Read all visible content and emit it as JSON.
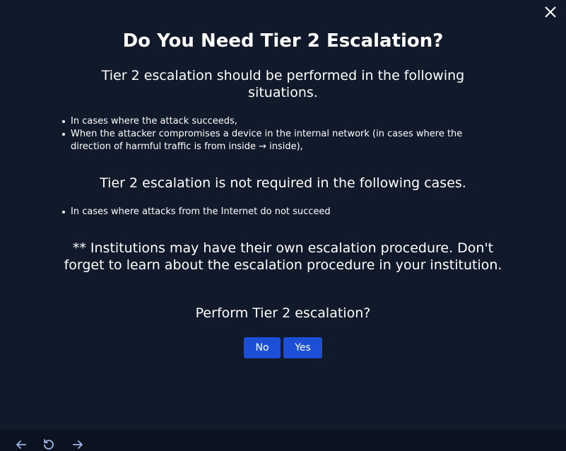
{
  "dialog": {
    "title": "Do You Need Tier 2 Escalation?",
    "section1_heading": "Tier 2 escalation should be performed in the following situations.",
    "section1_items": [
      "In cases where the attack succeeds,",
      "When the attacker compromises a device in the internal network (in cases where the direction of harmful traffic is from inside → inside),"
    ],
    "section2_heading": "Tier 2 escalation is not required in the following cases.",
    "section2_items": [
      "In cases where attacks from the Internet do not succeed"
    ],
    "note": "** Institutions may have their own escalation procedure. Don't forget to learn about the escalation procedure in your institution.",
    "question": "Perform Tier 2 escalation?",
    "no_label": "No",
    "yes_label": "Yes"
  },
  "icons": {
    "close": "close-icon",
    "back": "arrow-left-icon",
    "reload": "reload-icon",
    "forward": "arrow-right-icon"
  },
  "colors": {
    "background": "#111a2b",
    "button": "#1c4fd6",
    "bottom_bar": "#0b1220"
  }
}
